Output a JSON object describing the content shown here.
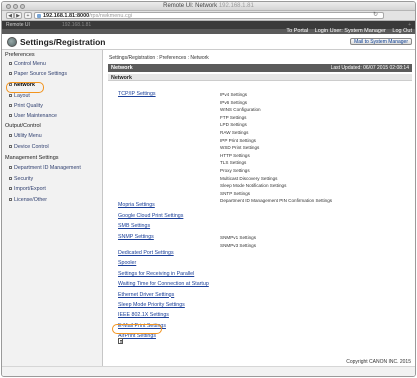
{
  "browser": {
    "window_title": "Remote UI: Network",
    "window_title_url": "192.168.1.81",
    "url_host": "192.168.1.81:8000",
    "url_path": "/rps/nwkmenu.cgi",
    "reload_glyph": "↻",
    "back_glyph": "◀",
    "forward_glyph": "▶",
    "add_glyph": "+",
    "tab_left": "Remote UI",
    "tab_mid": "192.168.1.81",
    "tab_right": "+"
  },
  "header": {
    "portal_link": "To Portal",
    "login_user": "Login User: System Manager",
    "logout_link": "Log Out",
    "app_title": "Settings/Registration",
    "mail_button": "Mail to System Manager"
  },
  "sidebar": {
    "sections": [
      {
        "heading": "Preferences",
        "items": [
          "Control Menu",
          "Paper Source Settings",
          "Network",
          "Layout",
          "Print Quality",
          "User Maintenance"
        ]
      },
      {
        "heading": "Output/Control",
        "items": [
          "Utility Menu",
          "Device Control"
        ]
      },
      {
        "heading": "Management Settings",
        "items": [
          "Department ID Management",
          "Security",
          "Import/Export",
          "License/Other"
        ]
      }
    ],
    "active_item": "Network"
  },
  "main": {
    "breadcrumb": "Settings/Registration : Preferences : Network",
    "section_title": "Network",
    "last_updated": "Last Updated: 06/07 2015 02:08:14",
    "subhead": "Network",
    "tcpip_link": "TCP/IP Settings",
    "tcpip_items": [
      "IPv4 Settings",
      "IPv6 Settings",
      "WINS Configuration",
      "FTP Settings",
      "LPD Settings",
      "RAW Settings",
      "IPP Print Settings",
      "WSD Print Settings",
      "HTTP Settings",
      "TLS Settings",
      "Proxy Settings",
      "Multicast Discovery Settings",
      "Sleep Mode Notification Settings",
      "SNTP Settings",
      "Department ID Management PIN Confirmation Settings"
    ],
    "links_a": [
      "Mopria Settings",
      "Google Cloud Print Settings",
      "SMB Settings"
    ],
    "snmp_link": "SNMP Settings",
    "snmp_items": [
      "SNMPv1 Settings",
      "SNMPv3 Settings"
    ],
    "links_b": [
      "Dedicated Port Settings",
      "Spooler",
      "Settings for Receiving in Parallel",
      "Waiting Time for Connection at Startup",
      "Ethernet Driver Settings",
      "Sleep Mode Priority Settings",
      "IEEE 802.1X Settings",
      "E-Mail Print Settings",
      "AirPrint Settings"
    ],
    "highlighted_link": "AirPrint Settings",
    "copyright": "Copyright CANON INC. 2015"
  },
  "colors": {
    "highlight": "#f2941f",
    "link": "#1a3f99",
    "section_bar": "#5b5b5b"
  }
}
